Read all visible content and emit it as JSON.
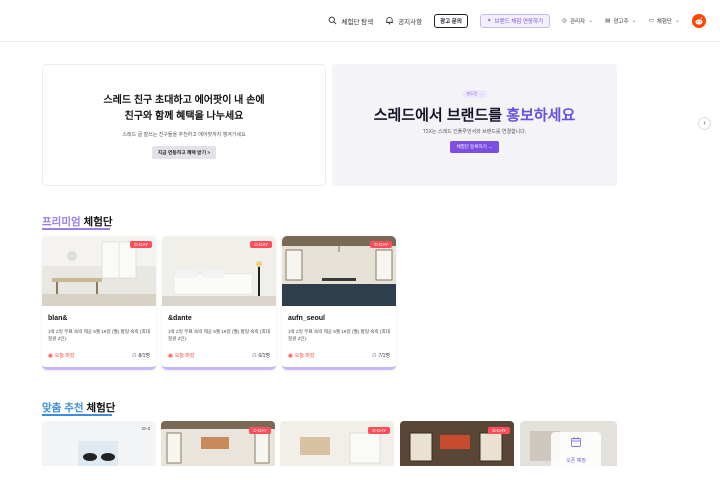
{
  "header": {
    "nav": {
      "search": "체험단 탐색",
      "notice": "공지사항",
      "ad_inquiry": "광고 문의",
      "brand_promo": "브랜드 체험 연동하기",
      "manager": "관리자",
      "advertiser": "광고주",
      "campaign": "체험단"
    }
  },
  "banner_left": {
    "line1": "스레드 친구 초대하고 에어팟이 내 손에",
    "line2": "친구와 함께 혜택을 나누세요",
    "desc": "스레드 글 잘쓰는 친구들을 추천하고 에어팟까지 챙겨가세요",
    "cta": "지금 연동하고 혜택 받기 >"
  },
  "banner_right": {
    "pill": "첫도전 →",
    "title_prefix": "스레드에서 브랜드를 ",
    "title_highlight": "홍보하세요",
    "sub": "T2X는 스레드 인플루언서와 브랜드를 연결합니다.",
    "cta": "체험단 등록하기 →"
  },
  "carousel_next": "›",
  "section_premium": {
    "accent": "프리미엄",
    "rest": " 체험단"
  },
  "section_custom": {
    "accent": "맞춤 추천",
    "rest": " 체험단"
  },
  "premium_cards": [
    {
      "badge": "D-DAY",
      "name": "blan&",
      "desc": "1박 2일 무료 숙박 제공 5월 19일 (월) 평일 숙박 (최대 정원 2인)",
      "deadline": "오늘 마감",
      "count": "8/1명"
    },
    {
      "badge": "D-DAY",
      "name": "&dante",
      "desc": "1박 2일 무료 숙박 제공 5월 19일 (월) 평일 숙박 (최대 정원 2인)",
      "deadline": "오늘 마감",
      "count": "6/1명"
    },
    {
      "badge": "D-DAY",
      "name": "aufn_seoul",
      "desc": "1박 2일 무료 숙박 제공 5월 19일 (월) 평일 숙박 (최대 정원 2인)",
      "deadline": "오늘 마감",
      "count": "7/1명"
    }
  ],
  "custom_cards": [
    {
      "badge": "D-4"
    },
    {
      "badge": "D-DAY"
    },
    {
      "badge": "D-DAY"
    },
    {
      "badge": "D-DAY"
    }
  ],
  "float_box": {
    "label": "오픈 예정"
  },
  "colors": {
    "accent": "#9a7bf0",
    "blue_accent": "#3c8dde",
    "dday": "#ff4d5a",
    "cta_purple": "#7c4ee4"
  }
}
